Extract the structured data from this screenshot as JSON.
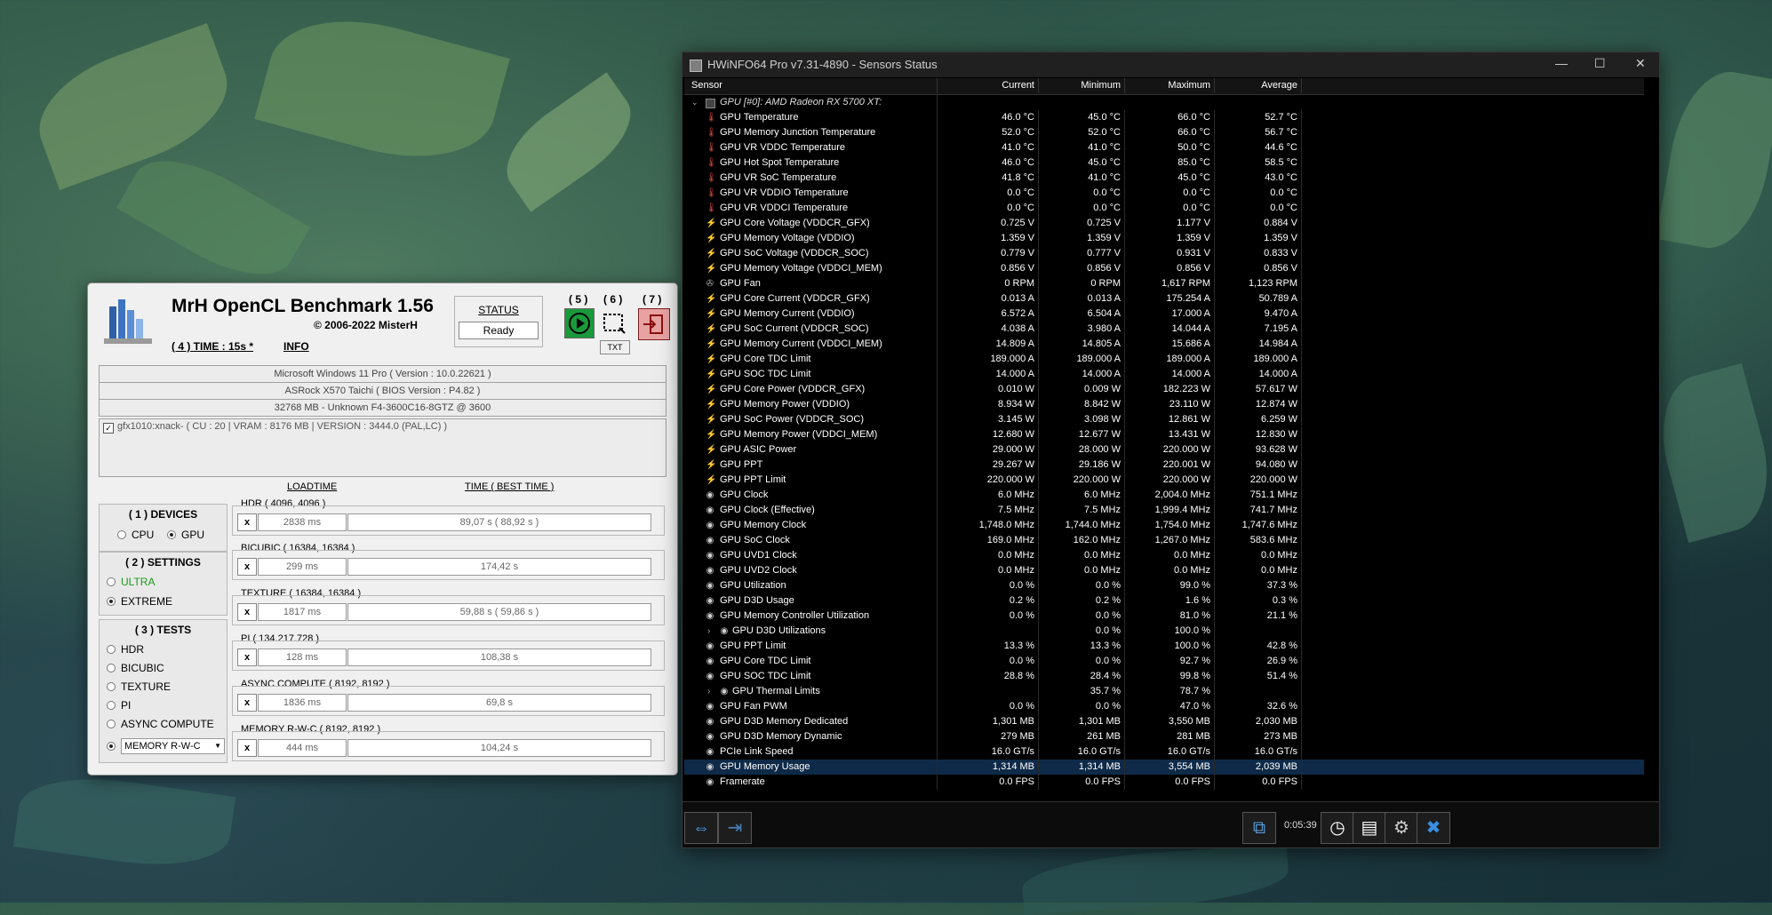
{
  "mrh": {
    "title": "MrH OpenCL Benchmark 1.56",
    "copyright": "© 2006-2022 MisterH",
    "time_link": "( 4 ) TIME : 15s *",
    "info_link": "INFO",
    "status_label": "STATUS",
    "status_value": "Ready",
    "btn5_label": "( 5 )",
    "btn6_label": "( 6 )",
    "btn7_label": "( 7 )",
    "txt_label": "TXT",
    "system_info": [
      "Microsoft Windows 11 Pro ( Version : 10.0.22621 )",
      "ASRock X570 Taichi ( BIOS Version : P4.82 )",
      "32768 MB - Unknown F4-3600C16-8GTZ @ 3600"
    ],
    "device_entry": "gfx1010:xnack- ( CU : 20 | VRAM : 8176 MB | VERSION : 3444.0 (PAL,LC) )",
    "col_loadtime": "LOADTIME",
    "col_time": "TIME ( BEST TIME )",
    "devices": {
      "title": "( 1 ) DEVICES",
      "cpu": "CPU",
      "gpu": "GPU",
      "selected": "GPU"
    },
    "settings": {
      "title": "( 2 ) SETTINGS",
      "ultra": "ULTRA",
      "extreme": "EXTREME",
      "selected": "EXTREME"
    },
    "tests": {
      "title": "( 3 ) TESTS",
      "items": [
        "HDR",
        "BICUBIC",
        "TEXTURE",
        "PI",
        "ASYNC COMPUTE"
      ],
      "select_value": "MEMORY R-W-C"
    },
    "results": [
      {
        "name": "HDR ( 4096, 4096 )",
        "x": "x",
        "load": "2838 ms",
        "time": "89,07 s ( 88,92 s )"
      },
      {
        "name": "BICUBIC ( 16384, 16384 )",
        "x": "x",
        "load": "299 ms",
        "time": "174,42 s"
      },
      {
        "name": "TEXTURE ( 16384, 16384 )",
        "x": "x",
        "load": "1817 ms",
        "time": "59,88 s ( 59,86 s )"
      },
      {
        "name": "PI ( 134.217.728 )",
        "x": "x",
        "load": "128 ms",
        "time": "108,38 s"
      },
      {
        "name": "ASYNC COMPUTE ( 8192, 8192 )",
        "x": "x",
        "load": "1836 ms",
        "time": "69,8 s"
      },
      {
        "name": "MEMORY R-W-C ( 8192, 8192 )",
        "x": "x",
        "load": "444 ms",
        "time": "104,24 s"
      }
    ]
  },
  "hwinfo": {
    "title": "HWiNFO64 Pro v7.31-4890 - Sensors Status",
    "headers": [
      "Sensor",
      "Current",
      "Minimum",
      "Maximum",
      "Average"
    ],
    "group": "GPU [#0]: AMD Radeon RX 5700 XT:",
    "timer": "0:05:39",
    "rows": [
      [
        "temp",
        "GPU Temperature",
        "46.0 °C",
        "45.0 °C",
        "66.0 °C",
        "52.7 °C"
      ],
      [
        "temp",
        "GPU Memory Junction Temperature",
        "52.0 °C",
        "52.0 °C",
        "66.0 °C",
        "56.7 °C"
      ],
      [
        "temp",
        "GPU VR VDDC Temperature",
        "41.0 °C",
        "41.0 °C",
        "50.0 °C",
        "44.6 °C"
      ],
      [
        "temp",
        "GPU Hot Spot Temperature",
        "46.0 °C",
        "45.0 °C",
        "85.0 °C",
        "58.5 °C"
      ],
      [
        "temp",
        "GPU VR SoC Temperature",
        "41.8 °C",
        "41.0 °C",
        "45.0 °C",
        "43.0 °C"
      ],
      [
        "temp",
        "GPU VR VDDIO Temperature",
        "0.0 °C",
        "0.0 °C",
        "0.0 °C",
        "0.0 °C"
      ],
      [
        "temp",
        "GPU VR VDDCI Temperature",
        "0.0 °C",
        "0.0 °C",
        "0.0 °C",
        "0.0 °C"
      ],
      [
        "volt",
        "GPU Core Voltage (VDDCR_GFX)",
        "0.725 V",
        "0.725 V",
        "1.177 V",
        "0.884 V"
      ],
      [
        "volt",
        "GPU Memory Voltage (VDDIO)",
        "1.359 V",
        "1.359 V",
        "1.359 V",
        "1.359 V"
      ],
      [
        "volt",
        "GPU SoC Voltage (VDDCR_SOC)",
        "0.779 V",
        "0.777 V",
        "0.931 V",
        "0.833 V"
      ],
      [
        "volt",
        "GPU Memory Voltage (VDDCI_MEM)",
        "0.856 V",
        "0.856 V",
        "0.856 V",
        "0.856 V"
      ],
      [
        "fan",
        "GPU Fan",
        "0 RPM",
        "0 RPM",
        "1,617 RPM",
        "1,123 RPM"
      ],
      [
        "volt",
        "GPU Core Current (VDDCR_GFX)",
        "0.013 A",
        "0.013 A",
        "175.254 A",
        "50.789 A"
      ],
      [
        "volt",
        "GPU Memory Current (VDDIO)",
        "6.572 A",
        "6.504 A",
        "17.000 A",
        "9.470 A"
      ],
      [
        "volt",
        "GPU SoC Current (VDDCR_SOC)",
        "4.038 A",
        "3.980 A",
        "14.044 A",
        "7.195 A"
      ],
      [
        "volt",
        "GPU Memory Current (VDDCI_MEM)",
        "14.809 A",
        "14.805 A",
        "15.686 A",
        "14.984 A"
      ],
      [
        "volt",
        "GPU Core TDC Limit",
        "189.000 A",
        "189.000 A",
        "189.000 A",
        "189.000 A"
      ],
      [
        "volt",
        "GPU SOC TDC Limit",
        "14.000 A",
        "14.000 A",
        "14.000 A",
        "14.000 A"
      ],
      [
        "volt",
        "GPU Core Power (VDDCR_GFX)",
        "0.010 W",
        "0.009 W",
        "182.223 W",
        "57.617 W"
      ],
      [
        "volt",
        "GPU Memory Power (VDDIO)",
        "8.934 W",
        "8.842 W",
        "23.110 W",
        "12.874 W"
      ],
      [
        "volt",
        "GPU SoC Power (VDDCR_SOC)",
        "3.145 W",
        "3.098 W",
        "12.861 W",
        "6.259 W"
      ],
      [
        "volt",
        "GPU Memory Power (VDDCI_MEM)",
        "12.680 W",
        "12.677 W",
        "13.431 W",
        "12.830 W"
      ],
      [
        "volt",
        "GPU ASIC Power",
        "29.000 W",
        "28.000 W",
        "220.000 W",
        "93.628 W"
      ],
      [
        "volt",
        "GPU PPT",
        "29.267 W",
        "29.186 W",
        "220.001 W",
        "94.080 W"
      ],
      [
        "volt",
        "GPU PPT Limit",
        "220.000 W",
        "220.000 W",
        "220.000 W",
        "220.000 W"
      ],
      [
        "clock",
        "GPU Clock",
        "6.0 MHz",
        "6.0 MHz",
        "2,004.0 MHz",
        "751.1 MHz"
      ],
      [
        "clock",
        "GPU Clock (Effective)",
        "7.5 MHz",
        "7.5 MHz",
        "1,999.4 MHz",
        "741.7 MHz"
      ],
      [
        "clock",
        "GPU Memory Clock",
        "1,748.0 MHz",
        "1,744.0 MHz",
        "1,754.0 MHz",
        "1,747.6 MHz"
      ],
      [
        "clock",
        "GPU SoC Clock",
        "169.0 MHz",
        "162.0 MHz",
        "1,267.0 MHz",
        "583.6 MHz"
      ],
      [
        "clock",
        "GPU UVD1 Clock",
        "0.0 MHz",
        "0.0 MHz",
        "0.0 MHz",
        "0.0 MHz"
      ],
      [
        "clock",
        "GPU UVD2 Clock",
        "0.0 MHz",
        "0.0 MHz",
        "0.0 MHz",
        "0.0 MHz"
      ],
      [
        "clock",
        "GPU Utilization",
        "0.0 %",
        "0.0 %",
        "99.0 %",
        "37.3 %"
      ],
      [
        "clock",
        "GPU D3D Usage",
        "0.2 %",
        "0.2 %",
        "1.6 %",
        "0.3 %"
      ],
      [
        "clock",
        "GPU Memory Controller Utilization",
        "0.0 %",
        "0.0 %",
        "81.0 %",
        "21.1 %"
      ],
      [
        "sub",
        "GPU D3D Utilizations",
        "",
        "0.0 %",
        "100.0 %",
        ""
      ],
      [
        "clock",
        "GPU PPT Limit",
        "13.3 %",
        "13.3 %",
        "100.0 %",
        "42.8 %"
      ],
      [
        "clock",
        "GPU Core TDC Limit",
        "0.0 %",
        "0.0 %",
        "92.7 %",
        "26.9 %"
      ],
      [
        "clock",
        "GPU SOC TDC Limit",
        "28.8 %",
        "28.4 %",
        "99.8 %",
        "51.4 %"
      ],
      [
        "sub",
        "GPU Thermal Limits",
        "",
        "35.7 %",
        "78.7 %",
        ""
      ],
      [
        "clock",
        "GPU Fan PWM",
        "0.0 %",
        "0.0 %",
        "47.0 %",
        "32.6 %"
      ],
      [
        "clock",
        "GPU D3D Memory Dedicated",
        "1,301 MB",
        "1,301 MB",
        "3,550 MB",
        "2,030 MB"
      ],
      [
        "clock",
        "GPU D3D Memory Dynamic",
        "279 MB",
        "261 MB",
        "281 MB",
        "273 MB"
      ],
      [
        "clock",
        "PCIe Link Speed",
        "16.0 GT/s",
        "16.0 GT/s",
        "16.0 GT/s",
        "16.0 GT/s"
      ],
      [
        "clock",
        "GPU Memory Usage",
        "1,314 MB",
        "1,314 MB",
        "3,554 MB",
        "2,039 MB"
      ],
      [
        "clock",
        "Framerate",
        "0.0 FPS",
        "0.0 FPS",
        "0.0 FPS",
        "0.0 FPS"
      ]
    ],
    "selected_row": "GPU Memory Usage"
  }
}
